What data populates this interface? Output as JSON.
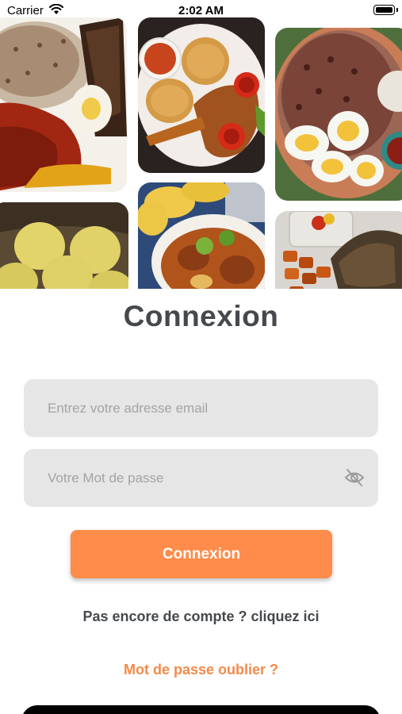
{
  "status_bar": {
    "carrier": "Carrier",
    "time": "2:02 AM"
  },
  "gallery": {
    "images": [
      "rice-stew-fish-egg-photo",
      "fufu-chicken-pepper-photo",
      "red-beans-rice-eggs-photo",
      "yam-balls-basket-photo",
      "mango-pepper-stew-photo",
      "grilled-fish-plantain-photo"
    ]
  },
  "login": {
    "title": "Connexion",
    "email_placeholder": "Entrez votre adresse email",
    "password_placeholder": "Votre Mot de passe",
    "submit_label": "Connexion",
    "signup_text": "Pas encore de compte ? cliquez ici",
    "forgot_text": "Mot de passe oublier ?"
  },
  "colors": {
    "accent": "#ff8c4a",
    "link": "#f48a49",
    "field_bg": "#e6e6e6",
    "text": "#45494d"
  }
}
